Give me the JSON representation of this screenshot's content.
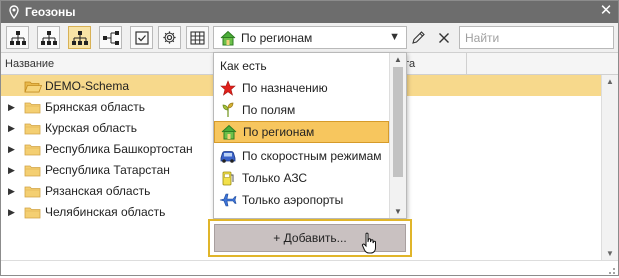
{
  "window": {
    "title": "Геозоны"
  },
  "toolbar": {
    "view_buttons": [
      {
        "icon": "tree-hierarchy-icon"
      },
      {
        "icon": "tree-hierarchy-icon"
      },
      {
        "icon": "tree-hierarchy-icon",
        "active": true
      },
      {
        "icon": "tree-branch-icon"
      },
      {
        "icon": "checkbox-icon"
      },
      {
        "icon": "gear-icon"
      },
      {
        "icon": "table-icon"
      }
    ],
    "grouping_select": {
      "value": "По регионам",
      "icon": "house-icon"
    },
    "edit_icon": "pencil-icon",
    "clear_icon": "close-icon",
    "search": {
      "placeholder": "Найти",
      "value": ""
    }
  },
  "grid": {
    "columns": [
      "Название",
      "дь, га"
    ],
    "rows": [
      {
        "name": "DEMO-Schema",
        "expandable": false,
        "selected": true
      },
      {
        "name": "Брянская область",
        "expandable": true
      },
      {
        "name": "Курская область",
        "expandable": true
      },
      {
        "name": "Республика Башкортостан",
        "expandable": true
      },
      {
        "name": "Республика Татарстан",
        "expandable": true
      },
      {
        "name": "Рязанская область",
        "expandable": true
      },
      {
        "name": "Челябинская область",
        "expandable": true
      }
    ]
  },
  "dropdown": {
    "items": [
      {
        "label": "Как есть",
        "icon": ""
      },
      {
        "label": "По назначению",
        "icon": "star-icon"
      },
      {
        "label": "По полям",
        "icon": "sprout-icon"
      },
      {
        "label": "По регионам",
        "icon": "house-icon",
        "selected": true
      },
      {
        "label": "По скоростным режимам",
        "icon": "car-icon"
      },
      {
        "label": "Только АЗС",
        "icon": "fuel-icon"
      },
      {
        "label": "Только аэропорты",
        "icon": "airplane-icon"
      }
    ],
    "add_button": "+ Добавить..."
  },
  "colors": {
    "titlebar": "#6d6d6d",
    "selection": "#f7d98c",
    "active_button": "#f7e3a6",
    "highlight_border": "#e0b52a"
  }
}
